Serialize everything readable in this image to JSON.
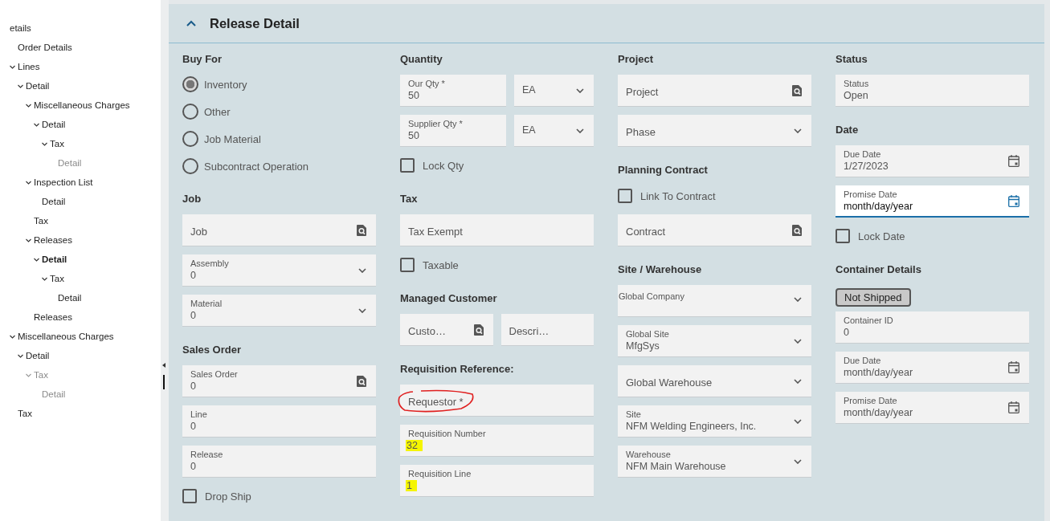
{
  "tree": [
    {
      "label": "etails",
      "selected": false,
      "disabled": false,
      "children": [
        {
          "label": "Order Details",
          "selected": false,
          "disabled": false
        },
        {
          "label": "Lines",
          "selected": false,
          "disabled": false,
          "expanded": true,
          "children": [
            {
              "label": "Detail",
              "selected": false,
              "disabled": false,
              "expanded": true,
              "children": [
                {
                  "label": "Miscellaneous Charges",
                  "selected": false,
                  "disabled": false,
                  "expanded": true,
                  "children": [
                    {
                      "label": "Detail",
                      "selected": false,
                      "disabled": false,
                      "expanded": true,
                      "children": [
                        {
                          "label": "Tax",
                          "selected": false,
                          "disabled": false,
                          "expanded": true,
                          "children": [
                            {
                              "label": "Detail",
                              "selected": false,
                              "disabled": true
                            }
                          ]
                        }
                      ]
                    }
                  ]
                },
                {
                  "label": "Inspection List",
                  "selected": false,
                  "disabled": false,
                  "expanded": true,
                  "children": [
                    {
                      "label": "Detail",
                      "selected": false,
                      "disabled": false
                    }
                  ]
                },
                {
                  "label": "Tax",
                  "selected": false,
                  "disabled": false
                },
                {
                  "label": "Releases",
                  "selected": false,
                  "disabled": false,
                  "expanded": true,
                  "children": [
                    {
                      "label": "Detail",
                      "selected": true,
                      "disabled": false,
                      "expanded": true,
                      "children": [
                        {
                          "label": "Tax",
                          "selected": false,
                          "disabled": false,
                          "expanded": true,
                          "children": [
                            {
                              "label": "Detail",
                              "selected": false,
                              "disabled": false
                            }
                          ]
                        }
                      ]
                    }
                  ]
                },
                {
                  "label": "Releases",
                  "selected": false,
                  "disabled": false
                }
              ]
            }
          ]
        },
        {
          "label": "Miscellaneous Charges",
          "selected": false,
          "disabled": false,
          "expanded": true,
          "children": [
            {
              "label": "Detail",
              "selected": false,
              "disabled": false,
              "expanded": true,
              "children": [
                {
                  "label": "Tax",
                  "selected": false,
                  "disabled": true,
                  "expanded": true,
                  "children": [
                    {
                      "label": "Detail",
                      "selected": false,
                      "disabled": true
                    }
                  ]
                }
              ]
            }
          ]
        },
        {
          "label": "Tax",
          "selected": false,
          "disabled": false
        }
      ]
    }
  ],
  "panel": {
    "title": "Release Detail",
    "expanded": true
  },
  "columns": [
    {
      "sections": [
        {
          "heading": "Buy For",
          "items": [
            {
              "kind": "radio_group",
              "options": [
                {
                  "label": "Inventory",
                  "selected": true
                },
                {
                  "label": "Other",
                  "selected": false
                },
                {
                  "label": "Job Material",
                  "selected": false
                },
                {
                  "label": "Subcontract Operation",
                  "selected": false
                }
              ]
            }
          ]
        },
        {
          "heading": "Job",
          "items": [
            {
              "kind": "lookup",
              "placeholder": "Job"
            },
            {
              "kind": "select",
              "label": "Assembly",
              "value": "0"
            },
            {
              "kind": "select",
              "label": "Material",
              "value": "0"
            }
          ]
        },
        {
          "heading": "Sales Order",
          "items": [
            {
              "kind": "lookup",
              "label": "Sales Order",
              "value": "0"
            },
            {
              "kind": "text",
              "label": "Line",
              "value": "0"
            },
            {
              "kind": "text",
              "label": "Release",
              "value": "0"
            },
            {
              "kind": "checkbox",
              "label": "Drop Ship",
              "checked": false
            }
          ]
        }
      ]
    },
    {
      "sections": [
        {
          "heading": "Quantity",
          "items": [
            {
              "kind": "field_row",
              "fields": [
                {
                  "kind": "text",
                  "label": "Our Qty *",
                  "value": "50"
                },
                {
                  "kind": "select",
                  "value": "EA"
                }
              ]
            },
            {
              "kind": "field_row",
              "fields": [
                {
                  "kind": "text",
                  "label": "Supplier Qty *",
                  "value": "50"
                },
                {
                  "kind": "select",
                  "value": "EA"
                }
              ]
            },
            {
              "kind": "checkbox",
              "label": "Lock Qty",
              "checked": false
            }
          ]
        },
        {
          "heading": "Tax",
          "items": [
            {
              "kind": "text",
              "placeholder": "Tax Exempt"
            },
            {
              "kind": "checkbox",
              "label": "Taxable",
              "checked": false
            }
          ]
        },
        {
          "heading": "Managed Customer",
          "items": [
            {
              "kind": "field_row",
              "fields": [
                {
                  "kind": "lookup",
                  "placeholder": "Custo…"
                },
                {
                  "kind": "text",
                  "placeholder": "Descri…"
                }
              ]
            }
          ]
        },
        {
          "heading": "Requisition Reference:",
          "items": [
            {
              "kind": "text",
              "placeholder": "Requestor *",
              "circled": true
            },
            {
              "kind": "text",
              "label": "Requisition Number",
              "value": "32",
              "highlighted": true
            },
            {
              "kind": "text",
              "label": "Requisition Line",
              "value": "1",
              "highlighted": true
            }
          ]
        }
      ]
    },
    {
      "sections": [
        {
          "heading": "Project",
          "items": [
            {
              "kind": "lookup",
              "placeholder": "Project"
            },
            {
              "kind": "select",
              "placeholder": "Phase"
            }
          ]
        },
        {
          "heading": "Planning Contract",
          "items": [
            {
              "kind": "checkbox",
              "label": "Link To Contract",
              "checked": false
            },
            {
              "kind": "lookup",
              "placeholder": "Contract"
            }
          ]
        },
        {
          "heading": "Site / Warehouse",
          "items": [
            {
              "kind": "select",
              "label": "Global Company"
            },
            {
              "kind": "select",
              "label": "Global Site",
              "value": "MfgSys"
            },
            {
              "kind": "select",
              "placeholder": "Global Warehouse"
            },
            {
              "kind": "select",
              "label": "Site",
              "value": "NFM Welding Engineers, Inc."
            },
            {
              "kind": "select",
              "label": "Warehouse",
              "value": "NFM Main Warehouse"
            }
          ]
        }
      ]
    },
    {
      "sections": [
        {
          "heading": "Status",
          "items": [
            {
              "kind": "text",
              "label": "Status",
              "value": "Open"
            }
          ]
        },
        {
          "heading": "Date",
          "items": [
            {
              "kind": "date",
              "label": "Due Date",
              "value": "1/27/2023"
            },
            {
              "kind": "date",
              "label": "Promise Date",
              "value": "month/day/year",
              "focused": true
            },
            {
              "kind": "checkbox",
              "label": "Lock Date",
              "checked": false
            }
          ]
        },
        {
          "heading": "Container Details",
          "items": [
            {
              "kind": "button",
              "label": "Not Shipped"
            },
            {
              "kind": "text",
              "label": "Container ID",
              "value": "0"
            },
            {
              "kind": "date",
              "label": "Due Date",
              "value": "month/day/year"
            },
            {
              "kind": "date",
              "label": "Promise Date",
              "value": "month/day/year"
            }
          ]
        }
      ]
    }
  ]
}
